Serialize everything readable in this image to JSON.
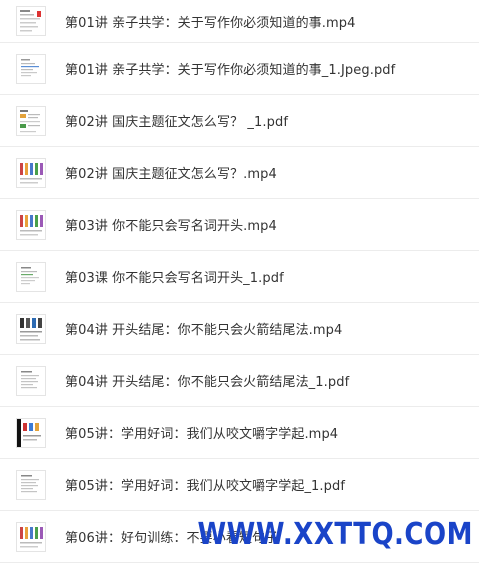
{
  "files": [
    {
      "name": "第01讲 亲子共学：关于写作你必须知道的事.mp4",
      "thumb": "doc-red-icon"
    },
    {
      "name": "第01讲 亲子共学：关于写作你必须知道的事_1.Jpeg.pdf",
      "thumb": "doc-blue-icon"
    },
    {
      "name": "第02讲 国庆主题征文怎么写？ _1.pdf",
      "thumb": "doc-mixed-icon"
    },
    {
      "name": "第02讲 国庆主题征文怎么写？.mp4",
      "thumb": "doc-columns-icon"
    },
    {
      "name": "第03讲 你不能只会写名词开头.mp4",
      "thumb": "doc-columns-icon"
    },
    {
      "name": "第03课 你不能只会写名词开头_1.pdf",
      "thumb": "doc-green-icon"
    },
    {
      "name": "第04讲 开头结尾：你不能只会火箭结尾法.mp4",
      "thumb": "doc-dark-icon"
    },
    {
      "name": "第04讲 开头结尾：你不能只会火箭结尾法_1.pdf",
      "thumb": "doc-plain-icon"
    },
    {
      "name": "第05讲：学用好词：我们从咬文嚼字学起.mp4",
      "thumb": "doc-black-icon"
    },
    {
      "name": "第05讲：学用好词：我们从咬文嚼字学起_1.pdf",
      "thumb": "doc-plain-icon"
    },
    {
      "name": "第06讲：好句训练：不要小看短句子",
      "thumb": "doc-columns-icon"
    }
  ],
  "watermark": "WWW.XXTTQ.COM",
  "colors": {
    "text": "#333333",
    "divider": "#ececec",
    "watermark": "#1a44c8"
  }
}
